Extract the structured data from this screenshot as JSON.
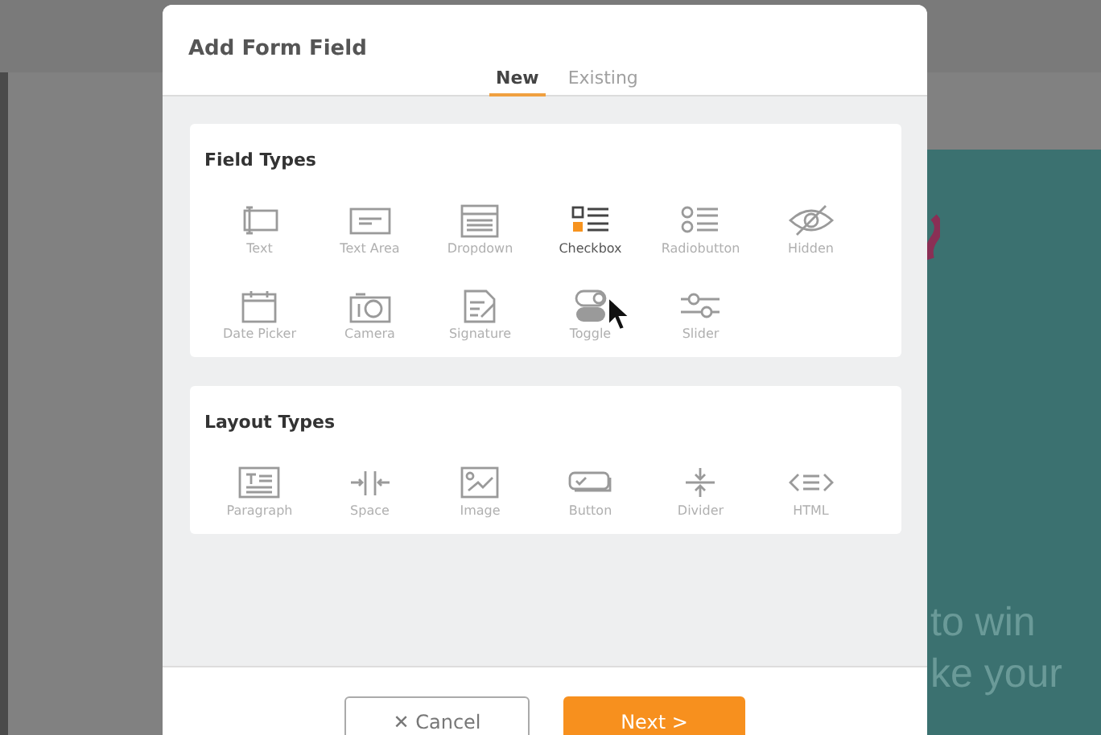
{
  "background": {
    "texts": [
      "to win",
      "ke your"
    ]
  },
  "dialog": {
    "title": "Add Form Field",
    "tabs": [
      {
        "label": "New",
        "selected": true
      },
      {
        "label": "Existing",
        "selected": false
      }
    ],
    "sections": [
      {
        "title": "Field Types",
        "items": [
          {
            "label": "Text",
            "selected": false
          },
          {
            "label": "Text Area",
            "selected": false
          },
          {
            "label": "Dropdown",
            "selected": false
          },
          {
            "label": "Checkbox",
            "selected": true
          },
          {
            "label": "Radiobutton",
            "selected": false
          },
          {
            "label": "Hidden",
            "selected": false
          },
          {
            "label": "Date Picker",
            "selected": false
          },
          {
            "label": "Camera",
            "selected": false
          },
          {
            "label": "Signature",
            "selected": false
          },
          {
            "label": "Toggle",
            "selected": false
          },
          {
            "label": "Slider",
            "selected": false
          }
        ]
      },
      {
        "title": "Layout Types",
        "items": [
          {
            "label": "Paragraph",
            "selected": false
          },
          {
            "label": "Space",
            "selected": false
          },
          {
            "label": "Image",
            "selected": false
          },
          {
            "label": "Button",
            "selected": false
          },
          {
            "label": "Divider",
            "selected": false
          },
          {
            "label": "HTML",
            "selected": false
          }
        ]
      }
    ],
    "buttons": [
      {
        "label": "✕ Cancel",
        "kind": "secondary"
      },
      {
        "label": "Next >",
        "kind": "primary"
      }
    ]
  }
}
